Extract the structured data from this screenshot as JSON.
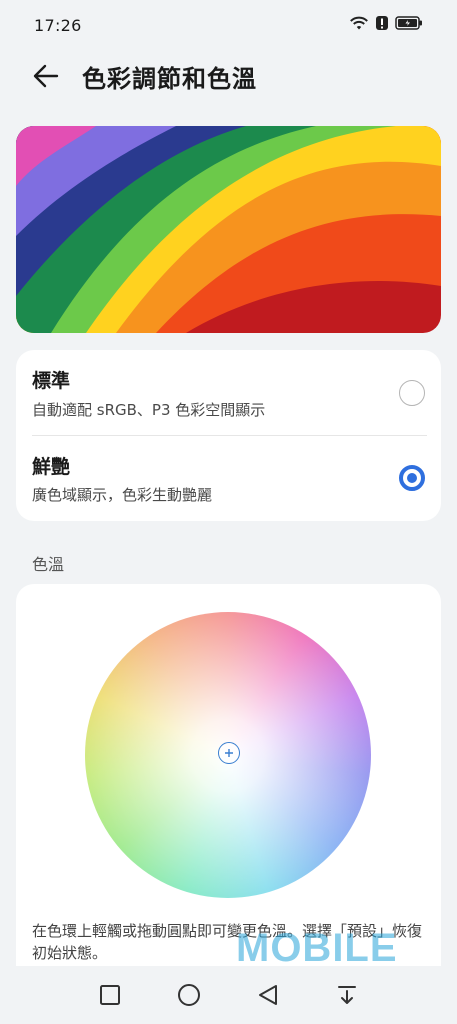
{
  "status_bar": {
    "time": "17:26",
    "icons": [
      "wifi-icon",
      "alert-icon",
      "battery-icon"
    ]
  },
  "app_bar": {
    "title": "色彩調節和色溫",
    "back_icon": "arrow-left-icon"
  },
  "color_modes": [
    {
      "title": "標準",
      "subtitle": "自動適配 sRGB、P3 色彩空間顯示",
      "selected": false
    },
    {
      "title": "鮮艷",
      "subtitle": "廣色域顯示，色彩生動艷麗",
      "selected": true
    }
  ],
  "color_temperature": {
    "section_label": "色溫",
    "description": "在色環上輕觸或拖動圓點即可變更色溫。選擇「預設」恢復初始狀態。"
  },
  "nav_bar": {
    "buttons": [
      "recent-apps-icon",
      "home-icon",
      "back-triangle-icon",
      "notification-pull-icon"
    ]
  },
  "watermark": {
    "text": "MOBILE"
  },
  "colors": {
    "accent": "#2f6fde",
    "background": "#f1f3f5",
    "card": "#ffffff"
  }
}
